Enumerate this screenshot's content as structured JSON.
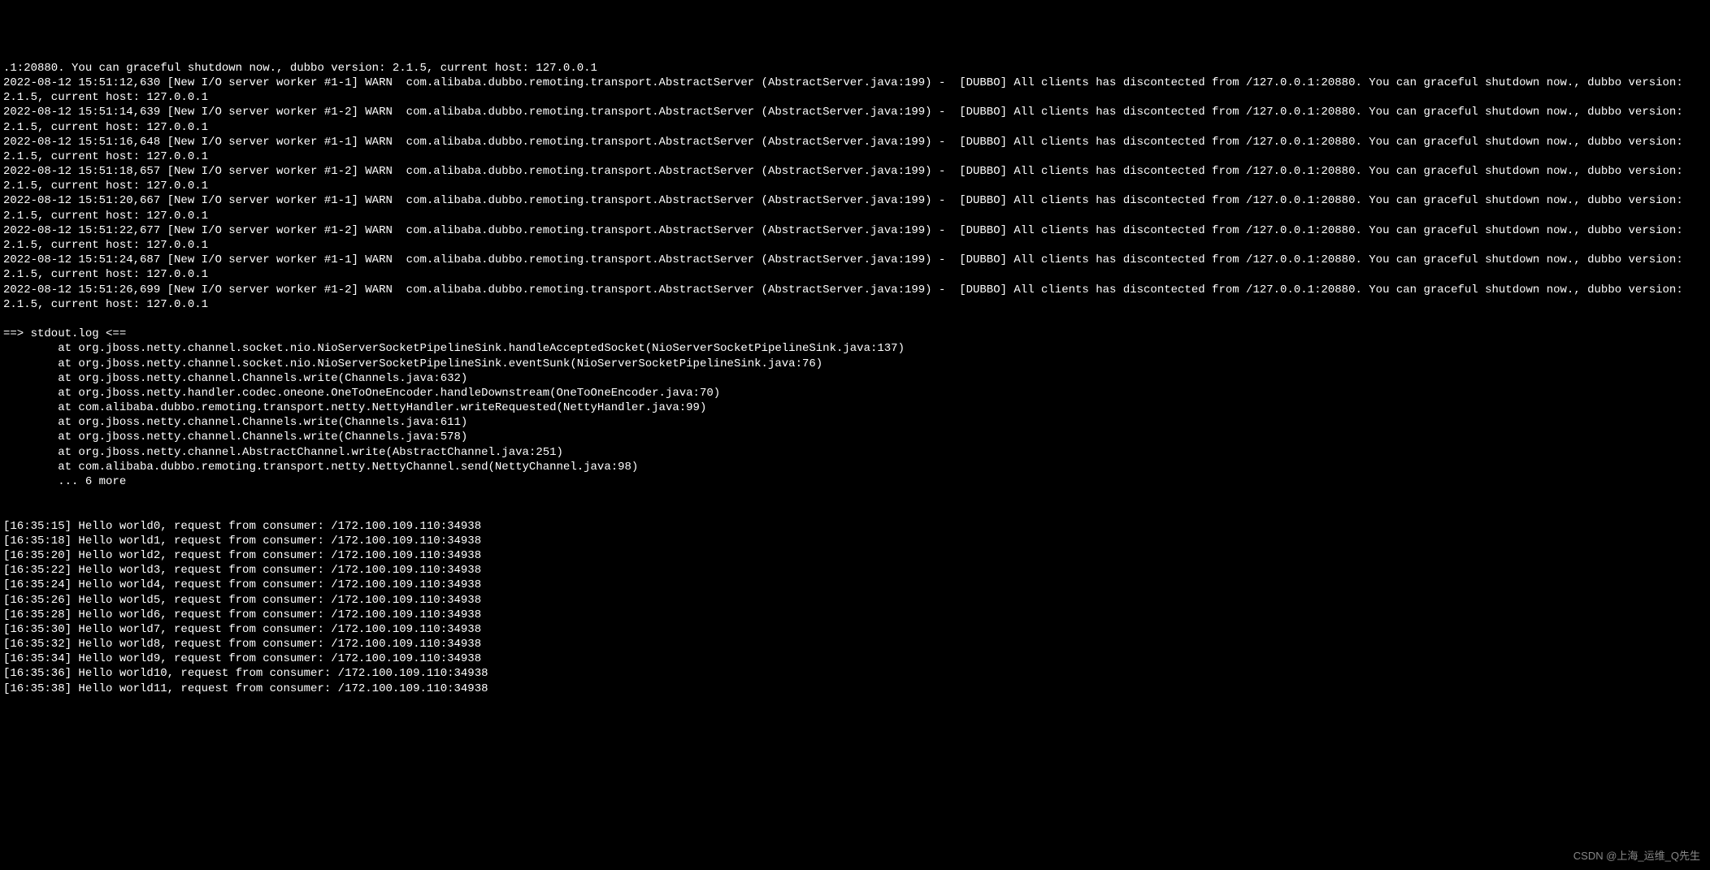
{
  "terminal": {
    "lines": [
      ".1:20880. You can graceful shutdown now., dubbo version: 2.1.5, current host: 127.0.0.1",
      "2022-08-12 15:51:12,630 [New I/O server worker #1-1] WARN  com.alibaba.dubbo.remoting.transport.AbstractServer (AbstractServer.java:199) -  [DUBBO] All clients has discontected from /127.0.0.1:20880. You can graceful shutdown now., dubbo version: 2.1.5, current host: 127.0.0.1",
      "2022-08-12 15:51:14,639 [New I/O server worker #1-2] WARN  com.alibaba.dubbo.remoting.transport.AbstractServer (AbstractServer.java:199) -  [DUBBO] All clients has discontected from /127.0.0.1:20880. You can graceful shutdown now., dubbo version: 2.1.5, current host: 127.0.0.1",
      "2022-08-12 15:51:16,648 [New I/O server worker #1-1] WARN  com.alibaba.dubbo.remoting.transport.AbstractServer (AbstractServer.java:199) -  [DUBBO] All clients has discontected from /127.0.0.1:20880. You can graceful shutdown now., dubbo version: 2.1.5, current host: 127.0.0.1",
      "2022-08-12 15:51:18,657 [New I/O server worker #1-2] WARN  com.alibaba.dubbo.remoting.transport.AbstractServer (AbstractServer.java:199) -  [DUBBO] All clients has discontected from /127.0.0.1:20880. You can graceful shutdown now., dubbo version: 2.1.5, current host: 127.0.0.1",
      "2022-08-12 15:51:20,667 [New I/O server worker #1-1] WARN  com.alibaba.dubbo.remoting.transport.AbstractServer (AbstractServer.java:199) -  [DUBBO] All clients has discontected from /127.0.0.1:20880. You can graceful shutdown now., dubbo version: 2.1.5, current host: 127.0.0.1",
      "2022-08-12 15:51:22,677 [New I/O server worker #1-2] WARN  com.alibaba.dubbo.remoting.transport.AbstractServer (AbstractServer.java:199) -  [DUBBO] All clients has discontected from /127.0.0.1:20880. You can graceful shutdown now., dubbo version: 2.1.5, current host: 127.0.0.1",
      "2022-08-12 15:51:24,687 [New I/O server worker #1-1] WARN  com.alibaba.dubbo.remoting.transport.AbstractServer (AbstractServer.java:199) -  [DUBBO] All clients has discontected from /127.0.0.1:20880. You can graceful shutdown now., dubbo version: 2.1.5, current host: 127.0.0.1",
      "2022-08-12 15:51:26,699 [New I/O server worker #1-2] WARN  com.alibaba.dubbo.remoting.transport.AbstractServer (AbstractServer.java:199) -  [DUBBO] All clients has discontected from /127.0.0.1:20880. You can graceful shutdown now., dubbo version: 2.1.5, current host: 127.0.0.1",
      "",
      "==> stdout.log <==",
      "        at org.jboss.netty.channel.socket.nio.NioServerSocketPipelineSink.handleAcceptedSocket(NioServerSocketPipelineSink.java:137)",
      "        at org.jboss.netty.channel.socket.nio.NioServerSocketPipelineSink.eventSunk(NioServerSocketPipelineSink.java:76)",
      "        at org.jboss.netty.channel.Channels.write(Channels.java:632)",
      "        at org.jboss.netty.handler.codec.oneone.OneToOneEncoder.handleDownstream(OneToOneEncoder.java:70)",
      "        at com.alibaba.dubbo.remoting.transport.netty.NettyHandler.writeRequested(NettyHandler.java:99)",
      "        at org.jboss.netty.channel.Channels.write(Channels.java:611)",
      "        at org.jboss.netty.channel.Channels.write(Channels.java:578)",
      "        at org.jboss.netty.channel.AbstractChannel.write(AbstractChannel.java:251)",
      "        at com.alibaba.dubbo.remoting.transport.netty.NettyChannel.send(NettyChannel.java:98)",
      "        ... 6 more",
      "",
      "",
      "[16:35:15] Hello world0, request from consumer: /172.100.109.110:34938",
      "[16:35:18] Hello world1, request from consumer: /172.100.109.110:34938",
      "[16:35:20] Hello world2, request from consumer: /172.100.109.110:34938",
      "[16:35:22] Hello world3, request from consumer: /172.100.109.110:34938",
      "[16:35:24] Hello world4, request from consumer: /172.100.109.110:34938",
      "[16:35:26] Hello world5, request from consumer: /172.100.109.110:34938",
      "[16:35:28] Hello world6, request from consumer: /172.100.109.110:34938",
      "[16:35:30] Hello world7, request from consumer: /172.100.109.110:34938",
      "[16:35:32] Hello world8, request from consumer: /172.100.109.110:34938",
      "[16:35:34] Hello world9, request from consumer: /172.100.109.110:34938",
      "[16:35:36] Hello world10, request from consumer: /172.100.109.110:34938",
      "[16:35:38] Hello world11, request from consumer: /172.100.109.110:34938"
    ]
  },
  "watermark": "CSDN @上海_运维_Q先生"
}
